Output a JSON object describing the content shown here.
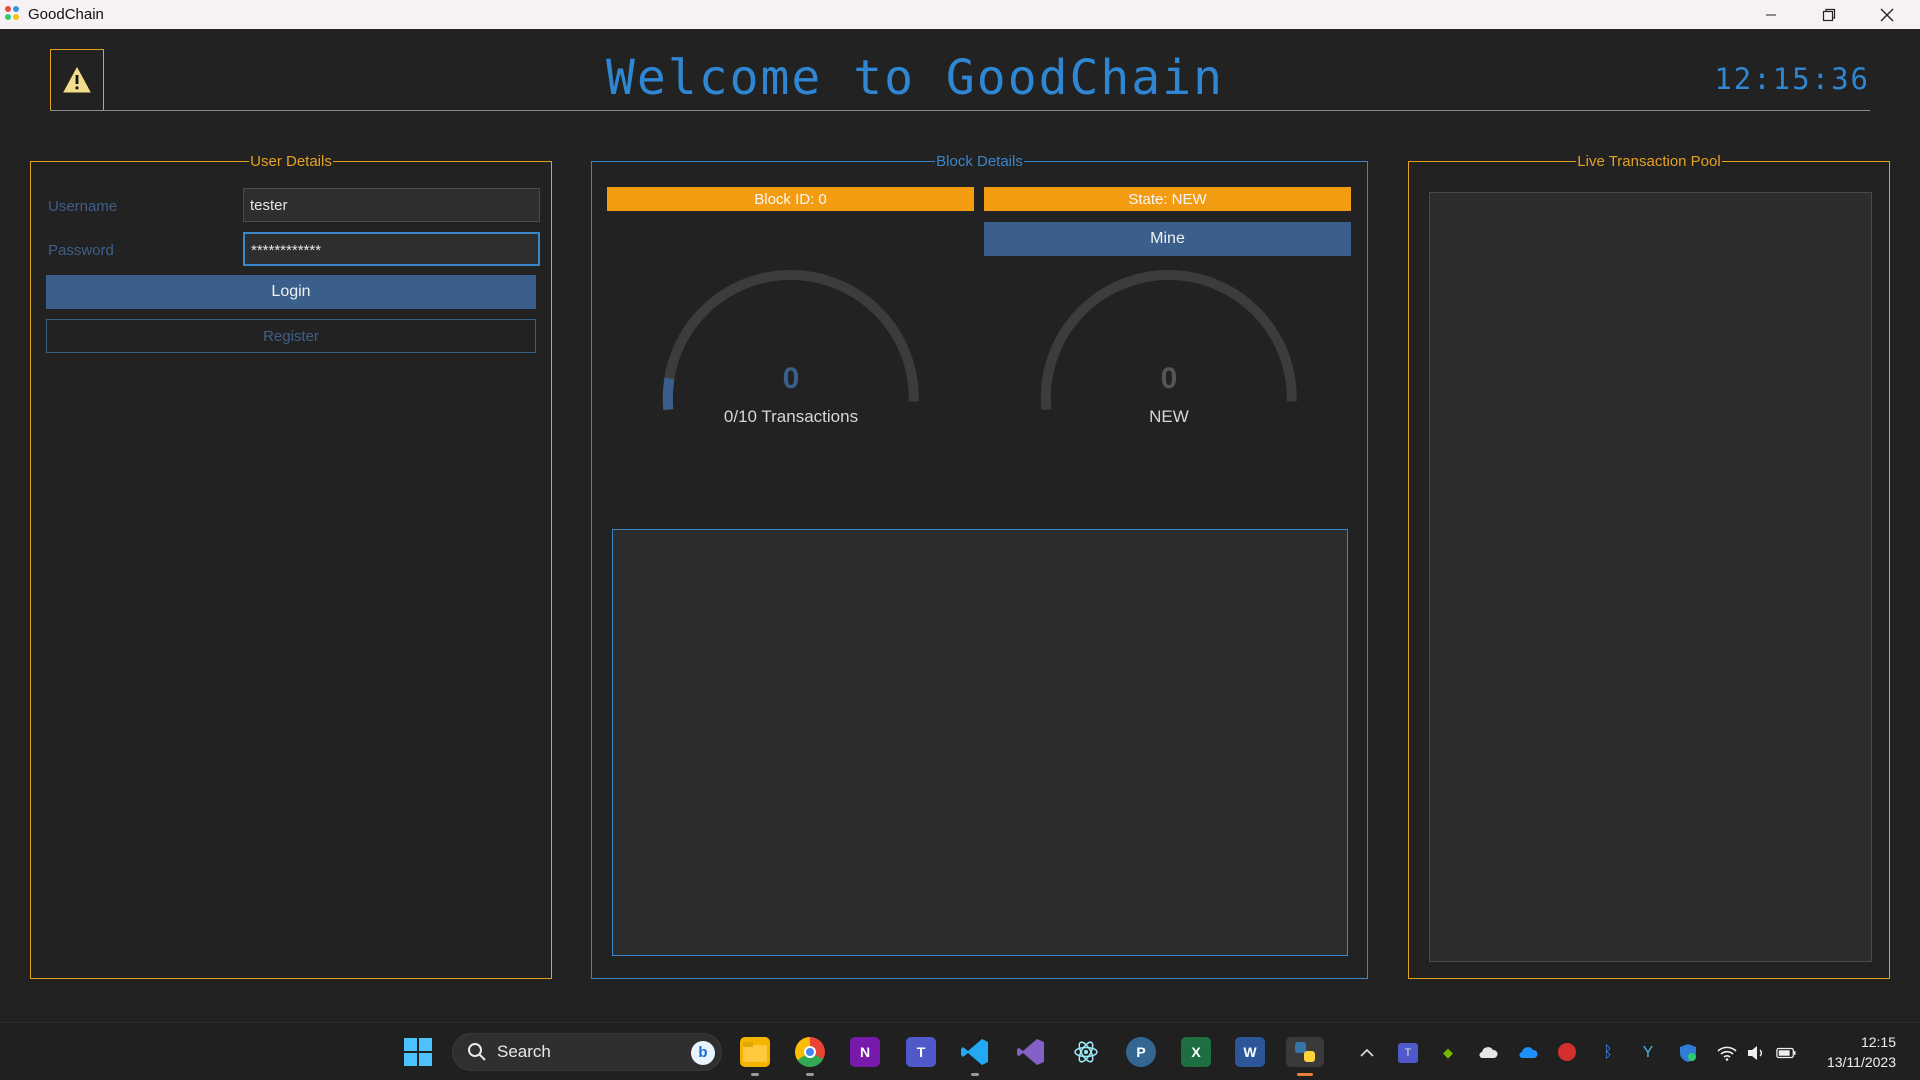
{
  "window": {
    "title": "GoodChain",
    "controls": [
      "minimize",
      "restore",
      "close"
    ]
  },
  "header": {
    "title": "Welcome to GoodChain",
    "clock": "12:15:36",
    "warning_icon": "warning-triangle-icon"
  },
  "user_details": {
    "title": "User Details",
    "username_label": "Username",
    "username_value": "tester",
    "password_label": "Password",
    "password_value": "************",
    "login_label": "Login",
    "register_label": "Register"
  },
  "block_details": {
    "title": "Block Details",
    "block_id": "Block ID: 0",
    "state": "State: NEW",
    "mine_label": "Mine",
    "gauge_transactions": {
      "value": "0",
      "label": "0/10 Transactions",
      "fraction": 0.0
    },
    "gauge_state": {
      "value": "0",
      "label": "NEW",
      "fraction": 0.0
    }
  },
  "pool": {
    "title": "Live Transaction Pool"
  },
  "taskbar": {
    "search_label": "Search",
    "apps": [
      "windows-start-icon",
      "file-explorer-icon",
      "chrome-icon",
      "onenote-icon",
      "teams-icon",
      "vscode-icon",
      "visual-studio-icon",
      "electron-icon",
      "postgresql-icon",
      "excel-icon",
      "word-icon",
      "python-icon"
    ],
    "time": "12:15",
    "date": "13/11/2023"
  },
  "colors": {
    "accent_orange": "#e6a21f",
    "accent_blue": "#3a86c8",
    "button_blue": "#3a5f8a",
    "background": "#222222"
  }
}
